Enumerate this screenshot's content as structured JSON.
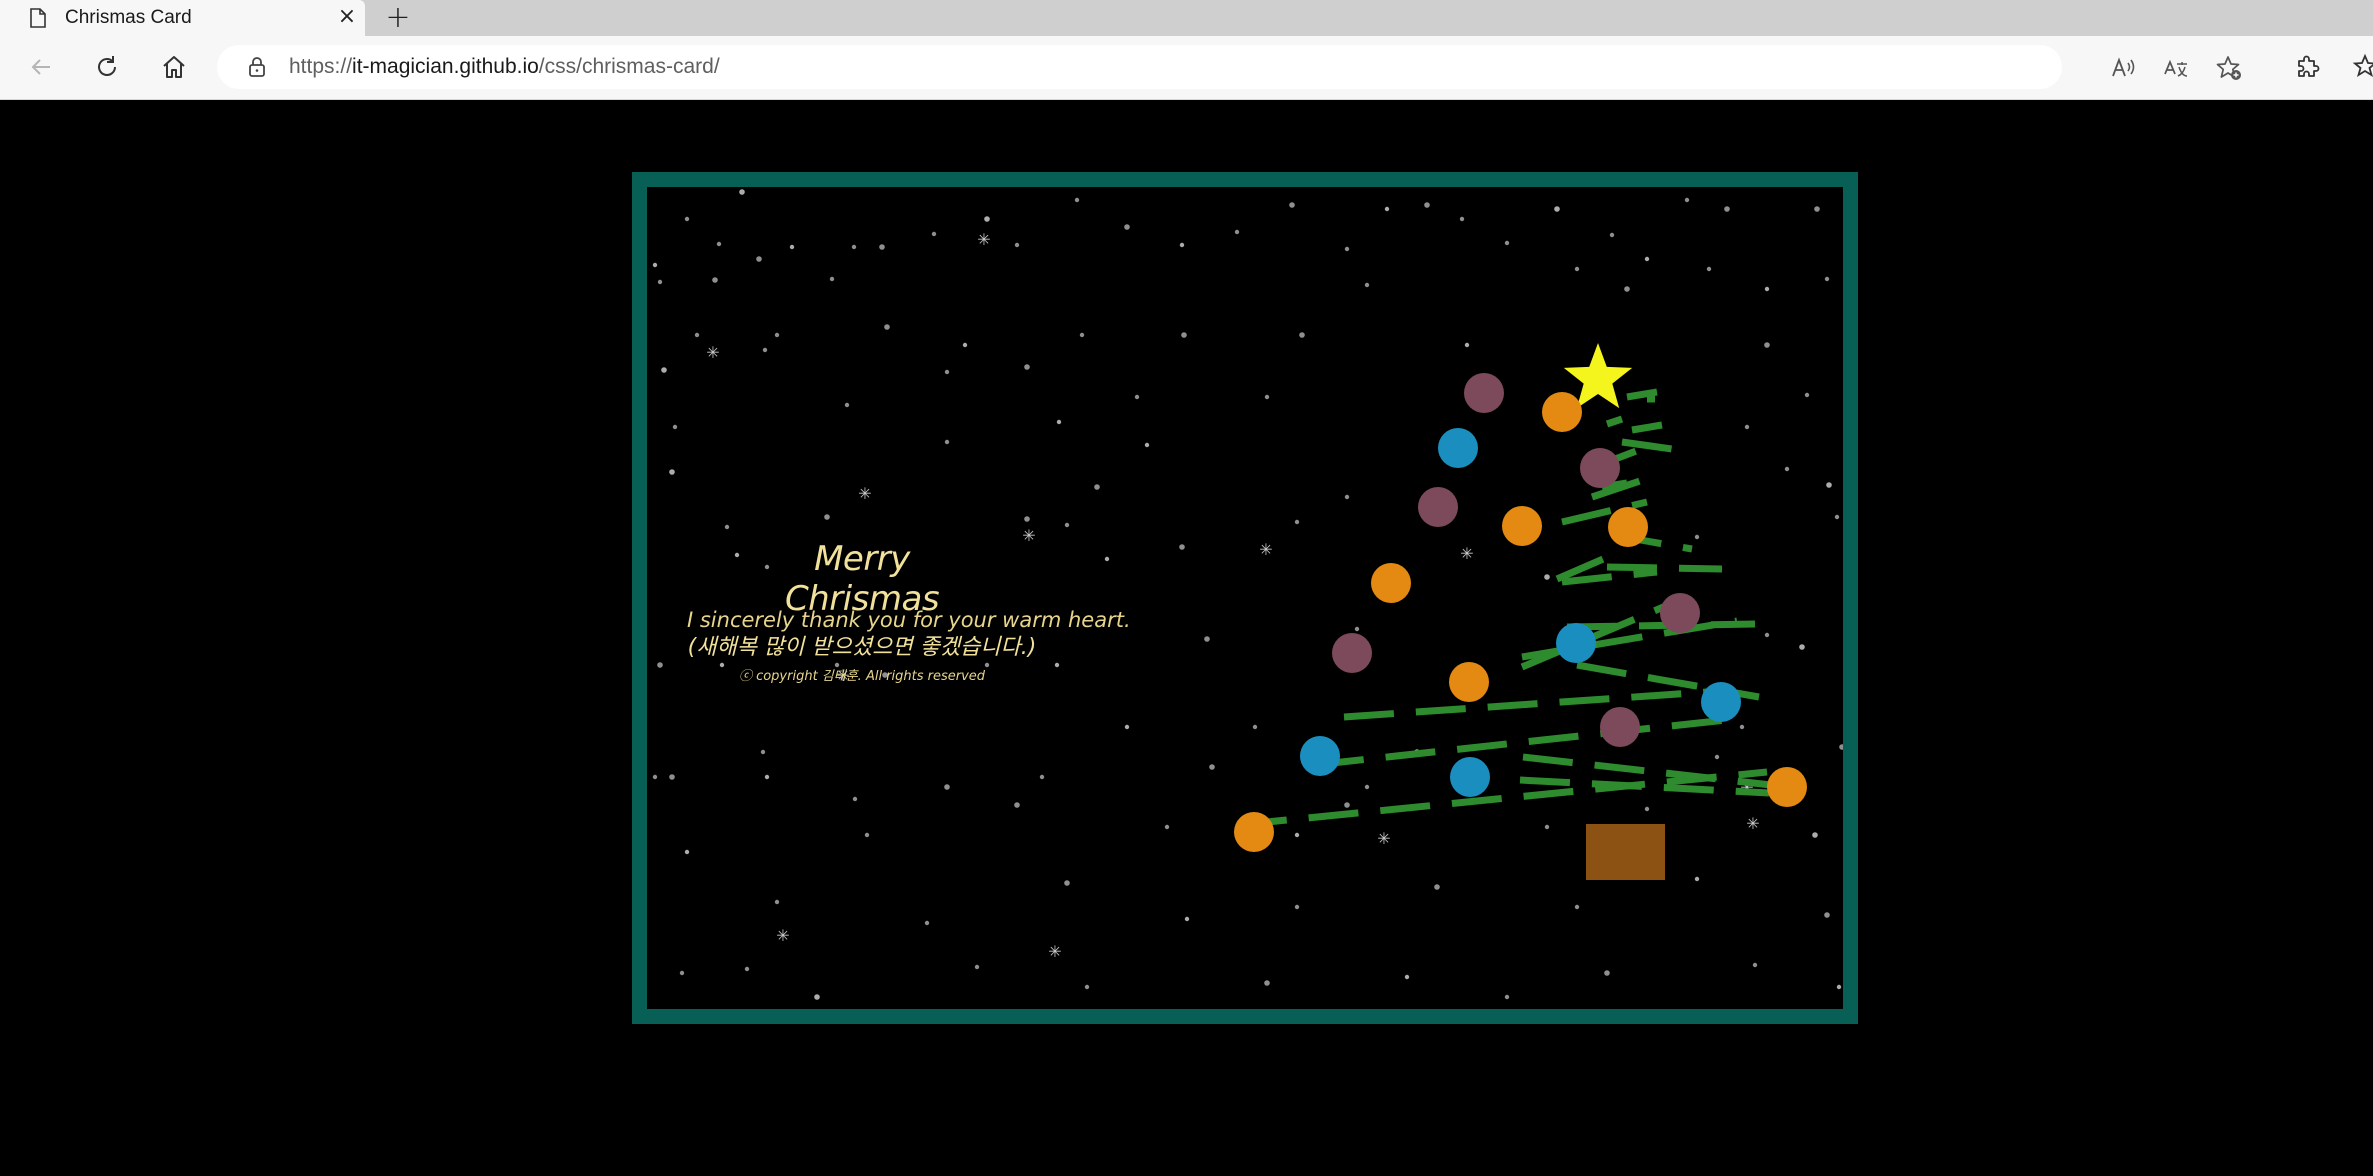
{
  "browser": {
    "tab_title": "Chrismas Card",
    "tab_close": "×",
    "new_tab": "+",
    "url_scheme": "https://",
    "url_host": "it-magician.github.io",
    "url_path": "/css/chrismas-card/"
  },
  "card": {
    "title": "Merry Chrismas",
    "message": "I sincerely thank you for your warm heart.",
    "message_korean": "(새해복 많이 받으셨으면 좋겠습니다.)",
    "copyright": "ⓒ copyright 김태훈. All rights reserved",
    "colors": {
      "frame": "#075f55",
      "text": "#f2e19a",
      "star": "#f5f51e",
      "garland": "#2e8b2e",
      "trunk": "#8b5214",
      "ornament_purple": "#7d4a5c",
      "ornament_orange": "#e48a12",
      "ornament_blue": "#1a8fbf"
    },
    "icons": [
      "star-icon",
      "snowflake-icon"
    ]
  }
}
